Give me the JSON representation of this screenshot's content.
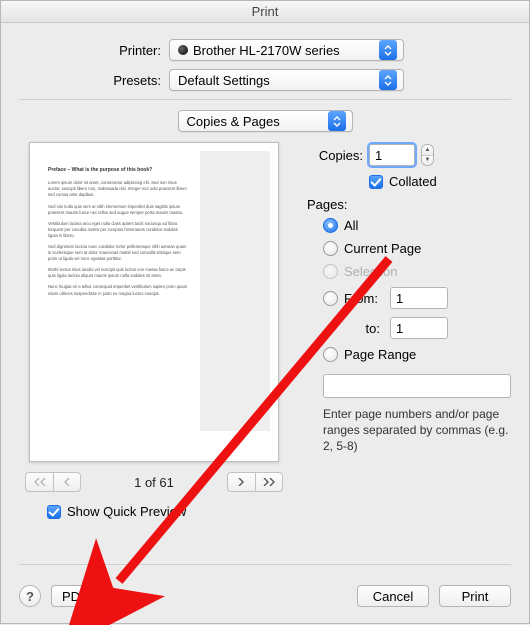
{
  "window": {
    "title": "Print"
  },
  "printer": {
    "label": "Printer:",
    "value": "Brother HL-2170W series"
  },
  "presets": {
    "label": "Presets:",
    "value": "Default Settings"
  },
  "section_selector": {
    "value": "Copies & Pages"
  },
  "copies": {
    "label": "Copies:",
    "value": "1"
  },
  "collated": {
    "label": "Collated",
    "checked": true
  },
  "pages": {
    "label": "Pages:",
    "options": {
      "all": "All",
      "current": "Current Page",
      "selection": "Selection",
      "from": "From:",
      "to": "to:",
      "from_value": "1",
      "to_value": "1",
      "page_range": "Page Range"
    },
    "range_value": "",
    "hint": "Enter page numbers and/or page ranges separated by commas (e.g. 2, 5-8)"
  },
  "preview": {
    "page_indicator": "1 of 61",
    "show_quick_label": "Show Quick Preview",
    "show_quick_checked": true
  },
  "buttons": {
    "pdf": "PDF",
    "help": "?",
    "cancel": "Cancel",
    "print": "Print"
  }
}
